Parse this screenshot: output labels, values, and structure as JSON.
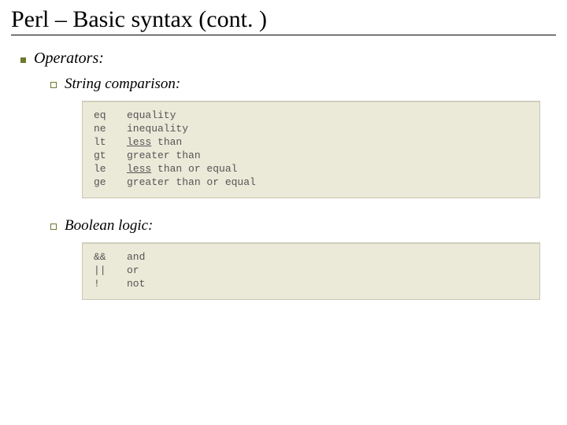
{
  "title": "Perl – Basic syntax (cont. )",
  "section": {
    "label": "Operators:"
  },
  "subsections": [
    {
      "label": "String comparison:",
      "rows": [
        {
          "op": "eq",
          "desc_prefix": "",
          "desc_underlined": "",
          "desc_suffix": "equality"
        },
        {
          "op": "ne",
          "desc_prefix": "",
          "desc_underlined": "",
          "desc_suffix": "inequality"
        },
        {
          "op": "lt",
          "desc_prefix": "",
          "desc_underlined": "less",
          "desc_suffix": " than"
        },
        {
          "op": "gt",
          "desc_prefix": "",
          "desc_underlined": "",
          "desc_suffix": "greater than"
        },
        {
          "op": "le",
          "desc_prefix": "",
          "desc_underlined": "less",
          "desc_suffix": " than or equal"
        },
        {
          "op": "ge",
          "desc_prefix": "",
          "desc_underlined": "",
          "desc_suffix": "greater than or equal"
        }
      ]
    },
    {
      "label": "Boolean logic:",
      "rows": [
        {
          "op": "&&",
          "desc_prefix": "",
          "desc_underlined": "",
          "desc_suffix": "and"
        },
        {
          "op": "||",
          "desc_prefix": "",
          "desc_underlined": "",
          "desc_suffix": "or"
        },
        {
          "op": "!",
          "desc_prefix": "",
          "desc_underlined": "",
          "desc_suffix": "not"
        }
      ]
    }
  ]
}
